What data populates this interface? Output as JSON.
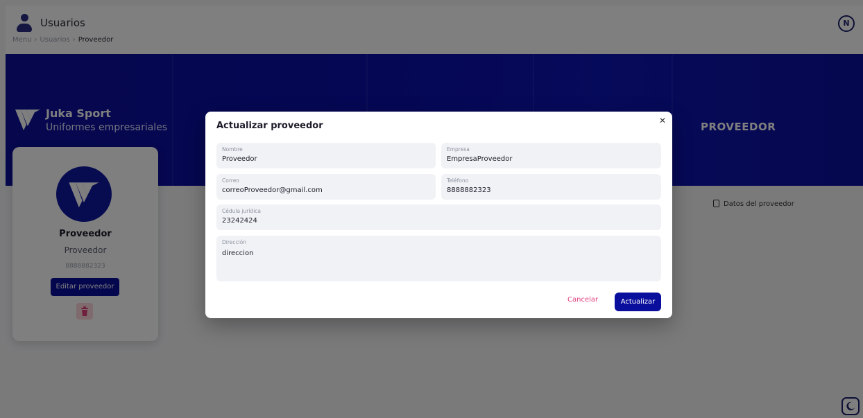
{
  "header": {
    "title": "Usuarios",
    "breadcrumb": [
      "Menu",
      "Usuarios",
      "Proveedor"
    ],
    "avatar_initial": "N"
  },
  "banner": {
    "brand_name": "Juka Sport",
    "brand_subtitle": "Uniformes empresariales",
    "section_title": "PROVEEDOR"
  },
  "profile_card": {
    "name": "Proveedor",
    "company": "Proveedor",
    "phone": "8888882323",
    "edit_label": "Editar proveedor"
  },
  "side_link": {
    "label": "Datos del proveedor"
  },
  "modal": {
    "title": "Actualizar proveedor",
    "fields": {
      "nombre": {
        "label": "Nombre",
        "value": "Proveedor"
      },
      "empresa": {
        "label": "Empresa",
        "value": "EmpresaProveedor"
      },
      "correo": {
        "label": "Correo",
        "value": "correoProveedor@gmail.com"
      },
      "telefono": {
        "label": "Teléfono",
        "value": "8888882323"
      },
      "cedula": {
        "label": "Cédula jurídica",
        "value": "23242424"
      },
      "direccion": {
        "label": "Dirección",
        "value": "direccion"
      }
    },
    "cancel_label": "Cancelar",
    "submit_label": "Actualizar"
  },
  "icons": {
    "user": "user-icon",
    "close": "close-icon",
    "trash": "trash-icon",
    "document": "document-icon",
    "moon": "moon-icon",
    "brand": "juka-logo-icon"
  },
  "colors": {
    "primary": "#0a0e9c",
    "danger": "#e0407a",
    "danger_bg": "#ffd5dd"
  }
}
